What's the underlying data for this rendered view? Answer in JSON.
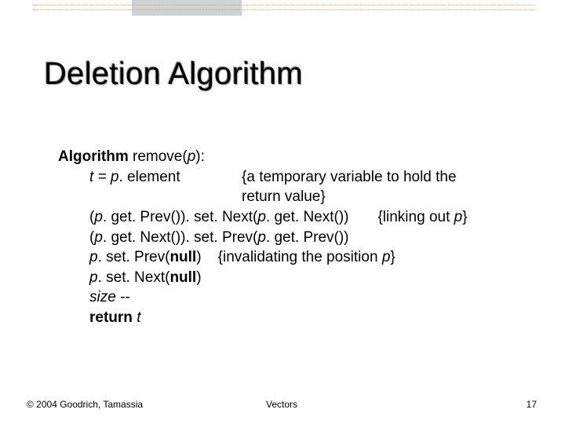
{
  "slide": {
    "title": "Deletion Algorithm",
    "algo": {
      "head_bold": "Algorithm",
      "head_rest": " remove(",
      "head_p": "p",
      "head_close": "):",
      "l1_t": "t = p",
      "l1_mid": ". element",
      "l1_comment1": "{a temporary variable to hold the",
      "l1_comment2": "return value}",
      "l2_left": "(",
      "l2_p1": "p",
      "l2_mid": ". get. Prev()). set. Next(",
      "l2_p2": "p",
      "l2_end": ". get. Next())",
      "l2_comment_pre": "{linking out ",
      "l2_comment_p": "p",
      "l2_comment_post": "}",
      "l3_left": "(",
      "l3_p1": "p",
      "l3_mid": ". get. Next()). set. Prev(",
      "l3_p2": "p",
      "l3_end": ". get. Prev())",
      "l4_p": "p",
      "l4_mid": ". set. Prev(",
      "l4_null": "null",
      "l4_close": ")",
      "l4_comment_pre": "{invalidating the position ",
      "l4_comment_p": "p",
      "l4_comment_post": "}",
      "l5_p": "p",
      "l5_mid": ". set. Next(",
      "l5_null": "null",
      "l5_close": ")",
      "l6_size": "size",
      "l6_dec": " --",
      "l7_ret": "return ",
      "l7_t": "t"
    }
  },
  "footer": {
    "copyright": "© 2004 Goodrich, Tamassia",
    "center": "Vectors",
    "page": "17"
  }
}
